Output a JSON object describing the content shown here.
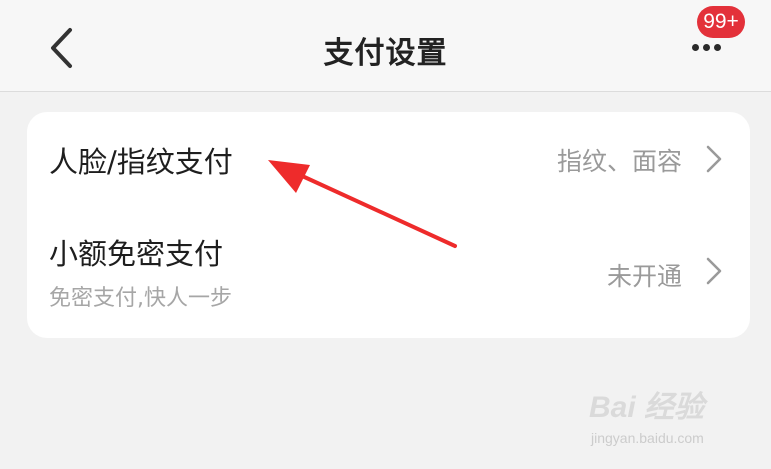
{
  "header": {
    "title": "支付设置",
    "back_icon": "chevron-left-icon",
    "more_icon": "more-dots-icon",
    "badge": "99+",
    "badge_color": "#e3313a"
  },
  "settings": {
    "items": [
      {
        "label": "人脸/指纹支付",
        "value": "指纹、面容",
        "icon": "chevron-right-icon"
      },
      {
        "label": "小额免密支付",
        "sublabel": "免密支付,快人一步",
        "value": "未开通",
        "icon": "chevron-right-icon"
      }
    ]
  },
  "annotation": {
    "arrow_color": "#ee2b2b"
  },
  "watermark": {
    "text": "Bai 经验",
    "url": "jingyan.baidu.com"
  }
}
